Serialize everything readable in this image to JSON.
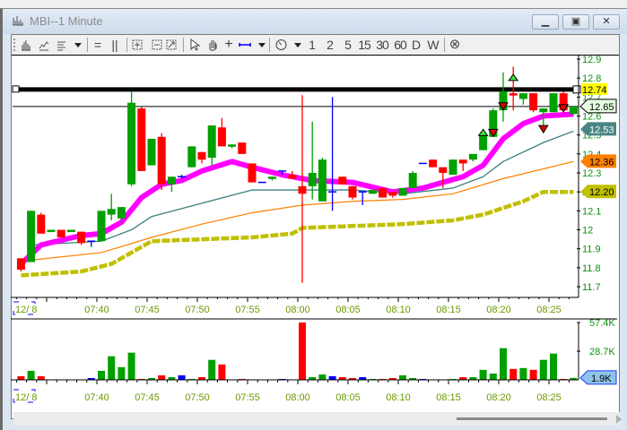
{
  "window": {
    "title": "MBI--1 Minute",
    "minimize": "▁",
    "maximize": "▣",
    "close": "✕"
  },
  "toolbar": {
    "items": [
      "chart-type",
      "line-chart",
      "bar-style",
      "separator-bars",
      "separator-columns",
      "zoom-in",
      "zoom-fit",
      "zoom-scale",
      "pointer",
      "hand",
      "crosshair",
      "measure-line",
      "clock"
    ],
    "intervals": [
      "1",
      "2",
      "5",
      "15",
      "30",
      "60",
      "D",
      "W"
    ],
    "close_all": "⊗"
  },
  "colors": {
    "up": "#00a000",
    "down": "#ff0000",
    "flat": "#0000ff",
    "ema_fast": "#ff00ff",
    "ema_mid": "#3d7f7f",
    "ema_slow": "#ff8000",
    "ema_long": "#c0c000"
  },
  "price_axis": {
    "ticks": [
      "12.9",
      "12.8",
      "12.7",
      "12.6",
      "12.5",
      "12.4",
      "12.3",
      "12.2",
      "12.1",
      "12",
      "11.9",
      "11.8",
      "11.7"
    ],
    "min": 11.7,
    "max": 12.9
  },
  "price_tags": [
    {
      "label": "12.74",
      "value": 12.74,
      "style": "hline",
      "bg": "#ffff00",
      "fg": "#000000"
    },
    {
      "label": "12.65",
      "value": 12.65,
      "style": "last",
      "bg": "#e6ffe0",
      "fg": "#000000"
    },
    {
      "label": "12.53",
      "value": 12.53,
      "style": "ema_mid",
      "bg": "#4a8585",
      "fg": "#ffffff"
    },
    {
      "label": "12.36",
      "value": 12.36,
      "style": "ema_slow",
      "bg": "#ff8000",
      "fg": "#000000"
    },
    {
      "label": "12.20",
      "value": 12.2,
      "style": "ema_long",
      "bg": "#c0c000",
      "fg": "#000000"
    }
  ],
  "time_axis": {
    "date": "12/ 8",
    "labels": [
      "07:40",
      "07:45",
      "07:50",
      "07:55",
      "08:00",
      "08:05",
      "08:10",
      "08:15",
      "08:20",
      "08:25"
    ]
  },
  "volume_axis": {
    "max_label": "57.4K",
    "mid_label": "28.7K",
    "last_label": "1.9K",
    "max": 57.4,
    "last": 1.9
  },
  "chart_data": {
    "type": "candlestick",
    "title": "MBI--1 Minute",
    "candles_format": [
      "time",
      "open",
      "high",
      "low",
      "close",
      "direction",
      "volume_k"
    ],
    "candles": [
      [
        "07:32",
        11.85,
        11.85,
        11.78,
        11.79,
        "down",
        3.6
      ],
      [
        "07:33",
        11.83,
        12.1,
        11.83,
        12.1,
        "up",
        9
      ],
      [
        "07:34",
        12.08,
        12.09,
        11.98,
        11.98,
        "down",
        3.6
      ],
      [
        "07:35",
        11.99,
        12.0,
        11.99,
        12.0,
        "up",
        0
      ],
      [
        "07:36",
        12.0,
        12.0,
        11.96,
        11.96,
        "down",
        0
      ],
      [
        "07:37",
        11.99,
        12.0,
        11.99,
        12.0,
        "up",
        0
      ],
      [
        "07:38",
        11.99,
        11.99,
        11.92,
        11.93,
        "down",
        0
      ],
      [
        "07:39",
        11.94,
        11.94,
        11.91,
        11.94,
        "flat",
        1.8
      ],
      [
        "07:40",
        11.94,
        12.1,
        11.94,
        12.1,
        "up",
        9
      ],
      [
        "07:41",
        12.08,
        12.19,
        12.05,
        12.11,
        "up",
        23.6
      ],
      [
        "07:42",
        12.06,
        12.12,
        12.04,
        12.12,
        "up",
        12.7
      ],
      [
        "07:43",
        12.24,
        12.73,
        12.23,
        12.67,
        "up",
        27.2
      ],
      [
        "07:44",
        12.64,
        12.65,
        12.31,
        12.31,
        "down",
        0.9
      ],
      [
        "07:45",
        12.34,
        12.48,
        12.34,
        12.48,
        "up",
        1.8
      ],
      [
        "07:46",
        12.49,
        12.51,
        12.21,
        12.24,
        "down",
        4.5
      ],
      [
        "07:47",
        12.24,
        12.28,
        12.2,
        12.28,
        "up",
        2.7
      ],
      [
        "07:48",
        12.28,
        12.29,
        12.27,
        12.28,
        "flat",
        4.5
      ],
      [
        "07:49",
        12.33,
        12.44,
        12.33,
        12.44,
        "up",
        0.9
      ],
      [
        "07:50",
        12.41,
        12.41,
        12.35,
        12.37,
        "down",
        2.7
      ],
      [
        "07:51",
        12.38,
        12.55,
        12.34,
        12.55,
        "up",
        20
      ],
      [
        "07:52",
        12.54,
        12.59,
        12.44,
        12.44,
        "down",
        15.4
      ],
      [
        "07:53",
        12.44,
        12.45,
        12.43,
        12.45,
        "up",
        0
      ],
      [
        "07:54",
        12.46,
        12.46,
        12.4,
        12.4,
        "down",
        0.9
      ],
      [
        "07:55",
        12.35,
        12.35,
        12.25,
        12.25,
        "down",
        0
      ],
      [
        "07:56",
        12.25,
        12.25,
        12.25,
        12.25,
        "flat",
        0
      ],
      [
        "07:57",
        12.27,
        12.28,
        12.26,
        12.28,
        "up",
        0
      ],
      [
        "07:58",
        12.31,
        12.31,
        12.29,
        12.31,
        "flat",
        0.9
      ],
      [
        "07:59",
        12.29,
        12.31,
        12.27,
        12.27,
        "down",
        0
      ],
      [
        "08:00",
        12.23,
        12.71,
        11.72,
        12.19,
        "down",
        57.4
      ],
      [
        "08:01",
        12.23,
        12.57,
        12.16,
        12.3,
        "up",
        2.7
      ],
      [
        "08:02",
        12.15,
        12.38,
        12.15,
        12.37,
        "up",
        5.4
      ],
      [
        "08:03",
        12.2,
        12.7,
        12.1,
        12.2,
        "flat",
        3.6
      ],
      [
        "08:04",
        12.28,
        12.28,
        12.24,
        12.24,
        "down",
        2.7
      ],
      [
        "08:05",
        12.23,
        12.23,
        12.16,
        12.17,
        "down",
        1.8
      ],
      [
        "08:06",
        12.2,
        12.2,
        12.13,
        12.2,
        "flat",
        2.7
      ],
      [
        "08:07",
        12.19,
        12.21,
        12.19,
        12.21,
        "up",
        0.9
      ],
      [
        "08:08",
        12.22,
        12.22,
        12.17,
        12.17,
        "down",
        0.9
      ],
      [
        "08:09",
        12.2,
        12.2,
        12.17,
        12.18,
        "down",
        1.8
      ],
      [
        "08:10",
        12.18,
        12.22,
        12.18,
        12.22,
        "up",
        4.5
      ],
      [
        "08:11",
        12.22,
        12.31,
        12.22,
        12.3,
        "up",
        1.8
      ],
      [
        "08:12",
        12.35,
        12.35,
        12.35,
        12.35,
        "flat",
        0.9
      ],
      [
        "08:13",
        12.37,
        12.37,
        12.33,
        12.33,
        "down",
        0
      ],
      [
        "08:14",
        12.33,
        12.33,
        12.22,
        12.3,
        "down",
        0
      ],
      [
        "08:15",
        12.29,
        12.37,
        12.29,
        12.37,
        "up",
        0.9
      ],
      [
        "08:16",
        12.37,
        12.37,
        12.31,
        12.35,
        "down",
        2.7
      ],
      [
        "08:17",
        12.37,
        12.4,
        12.36,
        12.4,
        "up",
        2.7
      ],
      [
        "08:18",
        12.42,
        12.52,
        12.42,
        12.5,
        "up",
        10
      ],
      [
        "08:19",
        12.49,
        12.64,
        12.49,
        12.63,
        "up",
        6.3
      ],
      [
        "08:20",
        12.63,
        12.83,
        12.57,
        12.73,
        "up",
        31.7
      ],
      [
        "08:21",
        12.72,
        12.86,
        12.63,
        12.71,
        "down",
        10.9
      ],
      [
        "08:22",
        12.69,
        12.72,
        12.66,
        12.72,
        "up",
        11.8
      ],
      [
        "08:23",
        12.72,
        12.72,
        12.62,
        12.63,
        "down",
        10
      ],
      [
        "08:24",
        12.62,
        12.64,
        12.51,
        12.64,
        "up",
        20
      ],
      [
        "08:25",
        12.62,
        12.72,
        12.62,
        12.72,
        "up",
        26.3
      ],
      [
        "08:26",
        12.72,
        12.73,
        12.63,
        12.63,
        "down",
        0.9
      ],
      [
        "08:27",
        12.61,
        12.65,
        12.61,
        12.65,
        "up",
        1.9
      ]
    ],
    "markers": [
      {
        "time": "08:18",
        "type": "up",
        "price": 12.53
      },
      {
        "time": "08:19",
        "type": "down",
        "price": 12.53
      },
      {
        "time": "08:20",
        "type": "down",
        "price": 12.67
      },
      {
        "time": "08:21",
        "type": "up",
        "price": 12.82
      },
      {
        "time": "08:24",
        "type": "down",
        "price": 12.55
      },
      {
        "time": "08:26",
        "type": "down",
        "price": 12.66
      }
    ],
    "hlines": [
      12.74,
      12.65
    ],
    "indicators": {
      "ema_fast": [
        [
          "07:32",
          11.82
        ],
        [
          "07:34",
          11.92
        ],
        [
          "07:38",
          11.97
        ],
        [
          "07:40",
          11.98
        ],
        [
          "07:42",
          12.04
        ],
        [
          "07:44",
          12.17
        ],
        [
          "07:46",
          12.24
        ],
        [
          "07:48",
          12.26
        ],
        [
          "07:50",
          12.31
        ],
        [
          "07:53",
          12.36
        ],
        [
          "07:55",
          12.33
        ],
        [
          "07:58",
          12.29
        ],
        [
          "08:01",
          12.26
        ],
        [
          "08:05",
          12.25
        ],
        [
          "08:09",
          12.2
        ],
        [
          "08:12",
          12.22
        ],
        [
          "08:16",
          12.28
        ],
        [
          "08:18",
          12.34
        ],
        [
          "08:20",
          12.48
        ],
        [
          "08:22",
          12.56
        ],
        [
          "08:24",
          12.6
        ],
        [
          "08:27",
          12.61
        ]
      ],
      "ema_mid": [
        [
          "07:33",
          11.92
        ],
        [
          "07:40",
          11.94
        ],
        [
          "07:43",
          12.0
        ],
        [
          "07:45",
          12.07
        ],
        [
          "07:50",
          12.14
        ],
        [
          "07:55",
          12.21
        ],
        [
          "08:00",
          12.21
        ],
        [
          "08:05",
          12.21
        ],
        [
          "08:10",
          12.19
        ],
        [
          "08:15",
          12.22
        ],
        [
          "08:18",
          12.28
        ],
        [
          "08:20",
          12.36
        ],
        [
          "08:24",
          12.46
        ],
        [
          "08:27",
          12.52
        ]
      ],
      "ema_slow": [
        [
          "07:33",
          11.84
        ],
        [
          "07:40",
          11.88
        ],
        [
          "07:45",
          11.96
        ],
        [
          "07:50",
          12.03
        ],
        [
          "07:55",
          12.09
        ],
        [
          "08:00",
          12.13
        ],
        [
          "08:05",
          12.15
        ],
        [
          "08:10",
          12.16
        ],
        [
          "08:15",
          12.19
        ],
        [
          "08:20",
          12.27
        ],
        [
          "08:27",
          12.36
        ]
      ],
      "ema_long": [
        [
          "07:32",
          11.76
        ],
        [
          "07:38",
          11.78
        ],
        [
          "07:41",
          11.82
        ],
        [
          "07:43",
          11.88
        ],
        [
          "07:45",
          11.94
        ],
        [
          "07:50",
          11.95
        ],
        [
          "07:55",
          11.96
        ],
        [
          "07:59",
          11.98
        ],
        [
          "08:00",
          12.01
        ],
        [
          "08:05",
          12.02
        ],
        [
          "08:10",
          12.03
        ],
        [
          "08:15",
          12.05
        ],
        [
          "08:18",
          12.08
        ],
        [
          "08:22",
          12.15
        ],
        [
          "08:24",
          12.2
        ],
        [
          "08:27",
          12.2
        ]
      ]
    },
    "ylim": [
      11.7,
      12.9
    ]
  }
}
